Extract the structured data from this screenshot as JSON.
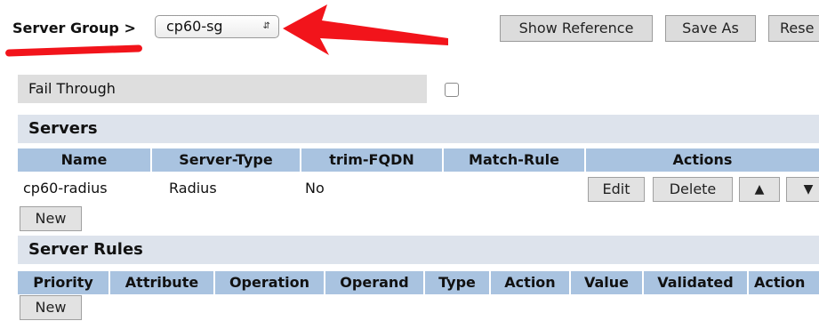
{
  "header": {
    "breadcrumb_label": "Server Group >",
    "server_group_value": "cp60-sg",
    "buttons": {
      "show_reference": "Show Reference",
      "save_as": "Save As",
      "reset": "Rese"
    }
  },
  "fail_through": {
    "label": "Fail Through",
    "checked": false
  },
  "servers": {
    "title": "Servers",
    "columns": [
      "Name",
      "Server-Type",
      "trim-FQDN",
      "Match-Rule",
      "Actions"
    ],
    "rows": [
      {
        "name": "cp60-radius",
        "server_type": "Radius",
        "trim_fqdn": "No",
        "match_rule": "",
        "actions": {
          "edit": "Edit",
          "delete": "Delete",
          "up": "▲",
          "down": "▼"
        }
      }
    ],
    "new_label": "New"
  },
  "server_rules": {
    "title": "Server Rules",
    "columns": [
      "Priority",
      "Attribute",
      "Operation",
      "Operand",
      "Type",
      "Action",
      "Value",
      "Validated",
      "Action"
    ],
    "new_label": "New"
  },
  "annotation": {
    "color": "#f2141b"
  }
}
